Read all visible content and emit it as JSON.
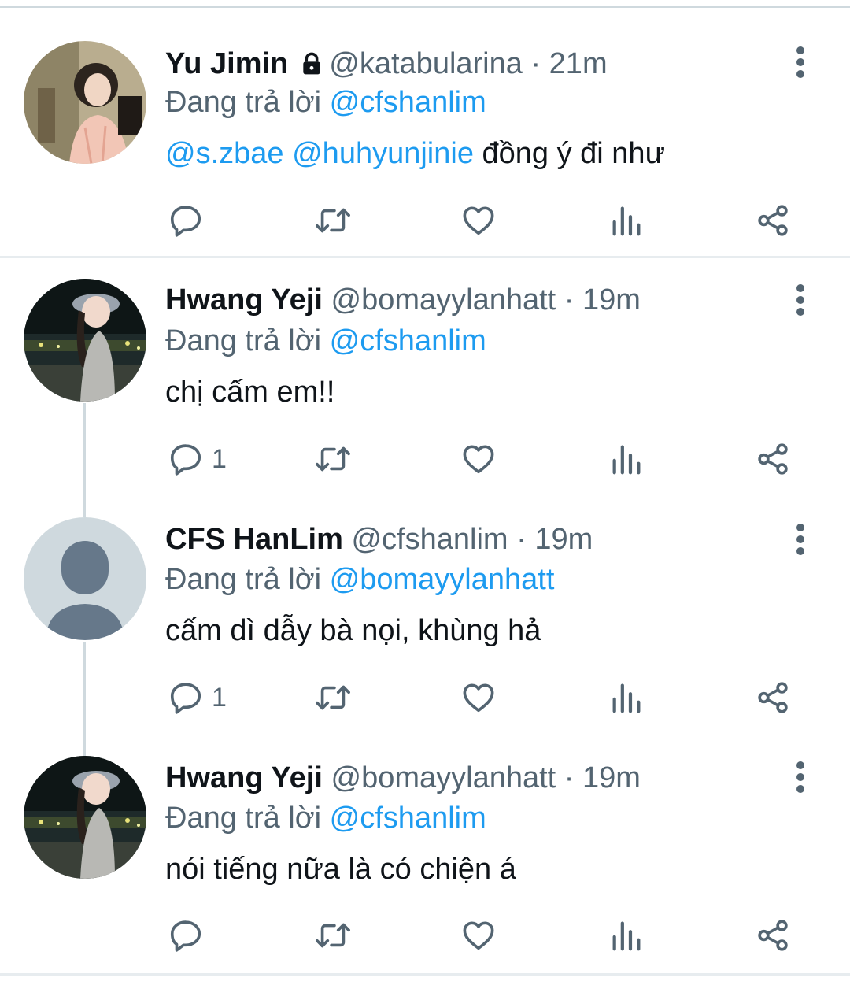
{
  "tweets": [
    {
      "name": "Yu Jimin",
      "protected": true,
      "handle": "@katabularina",
      "sep": "·",
      "time": "21m",
      "replying_prefix": "Đang trả lời",
      "replying_to": "@cfshanlim",
      "mentions": [
        "@s.zbae",
        "@huhyunjinie"
      ],
      "text": "đồng ý đi như",
      "reply_count": ""
    },
    {
      "name": "Hwang Yeji",
      "handle": "@bomayylanhatt",
      "sep": "·",
      "time": "19m",
      "replying_prefix": "Đang trả lời",
      "replying_to": "@cfshanlim",
      "text": "chị cấm em!!",
      "reply_count": "1"
    },
    {
      "name": "CFS HanLim",
      "handle": "@cfshanlim",
      "sep": "·",
      "time": "19m",
      "replying_prefix": "Đang trả lời",
      "replying_to": "@bomayylanhatt",
      "text": "cấm dì dẫy bà nọi, khùng hả",
      "reply_count": "1"
    },
    {
      "name": "Hwang Yeji",
      "handle": "@bomayylanhatt",
      "sep": "·",
      "time": "19m",
      "replying_prefix": "Đang trả lời",
      "replying_to": "@cfshanlim",
      "text": "nói tiếng nữa là có chiện á",
      "reply_count": ""
    }
  ],
  "icons": {
    "reply": "reply-icon",
    "retweet": "retweet-icon",
    "like": "heart-icon",
    "views": "analytics-icon",
    "share": "share-icon",
    "more": "more-vertical-icon",
    "protected": "lock-icon"
  },
  "colors": {
    "name": "#0f1419",
    "secondary": "#536471",
    "mention": "#1d9bf0",
    "thread_line": "#cfd9de",
    "divider": "#e7ecef",
    "default_avatar_bg": "#cfd9de",
    "default_avatar_fg": "#66788a"
  }
}
